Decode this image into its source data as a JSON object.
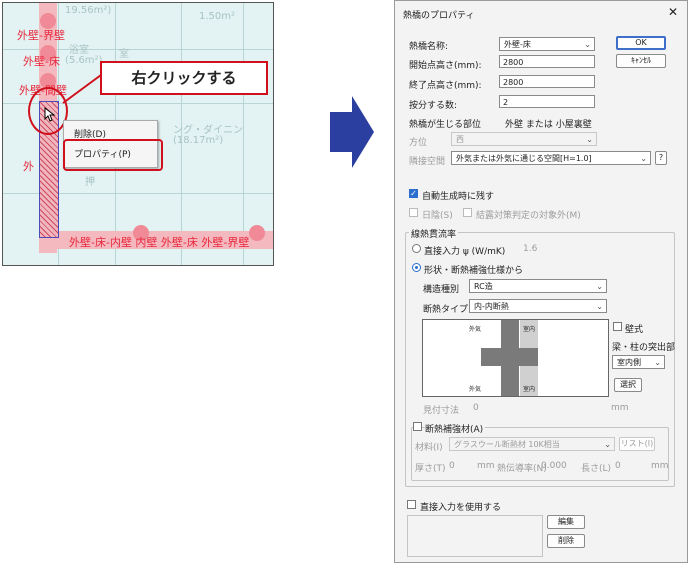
{
  "left_screenshot": {
    "wall_labels": {
      "top": "外壁-界壁",
      "floor": "外壁-床",
      "inner": "外壁-間壁",
      "left_lower": "外",
      "bottom": "外壁-床-内壁 内壁 外壁-床 外壁-界壁"
    },
    "room_labels": {
      "top": "19.56m²)",
      "top_right": "1.50m²",
      "washitsu": "浴室",
      "washitsu_area": "(5.6m²)",
      "dining": "ング・ダイニン",
      "dining_area": "(18.17m²)",
      "small": "押",
      "mid": "室"
    },
    "callout": "右クリックする",
    "context_menu": {
      "items": [
        "削除(D)",
        "プロパティ(P)"
      ]
    }
  },
  "dialog": {
    "title": "熱橋のプロパティ",
    "close_icon": "close-icon",
    "fields": {
      "name_label": "熱橋名称:",
      "name_value": "外壁-床",
      "start_label": "開始点高さ(mm):",
      "start_value": "2800",
      "end_label": "終了点高さ(mm):",
      "end_value": "2800",
      "split_label": "按分する数:",
      "split_value": "2"
    },
    "ok": "OK",
    "cancel": "ｷｬﾝｾﾙ",
    "part_label": "熱橋が生じる部位",
    "part_value": "外壁 または 小屋裏壁",
    "direction_label": "方位",
    "direction_value": "西",
    "adjacent_label": "隣接空間",
    "adjacent_value": "外気または外気に通じる空間[H=1.0]",
    "help": "?",
    "auto_label": "自動生成時に残す",
    "shade_label": "日陰(S)",
    "condensation_label": "結露対策判定の対象外(M)",
    "linear_group": "線熱貫流率",
    "direct_input_label": "直接入力 ψ (W/mK)",
    "direct_input_value": "1.6",
    "shape_label": "形状・断熱補強仕様から",
    "structure_label": "構造種別",
    "structure_value": "RC造",
    "insulation_label": "断熱タイプ",
    "insulation_value": "内-内断熱",
    "diagram": {
      "tl": "外気",
      "tr": "室内",
      "bl": "外気",
      "br": "室内"
    },
    "wall_type_label": "壁式",
    "beam_label": "梁・柱の突出部",
    "beam_value": "室内側",
    "select_button": "選択",
    "visible_dim_label": "見付寸法",
    "visible_dim_value": "0",
    "visible_dim_unit": "mm",
    "reinforce_label": "断熱補強材(A)",
    "material_label": "材料(I)",
    "material_value": "グラスウール断熱材 10K相当",
    "list_button": "リスト(I)",
    "thickness_label": "厚さ(T)",
    "thickness_value": "0",
    "thickness_unit": "mm",
    "conductivity_label": "熱伝導率(N)",
    "conductivity_value": "0.000",
    "length_label": "長さ(L)",
    "length_value": "0",
    "length_unit": "mm",
    "use_direct_label": "直接入力を使用する",
    "edit_button": "編集",
    "delete_button": "削除"
  },
  "colors": {
    "callout_border": "#d0101c",
    "arrow": "#2b3fa0",
    "wall_label": "#e8283c",
    "accent": "#2b6fcf"
  }
}
